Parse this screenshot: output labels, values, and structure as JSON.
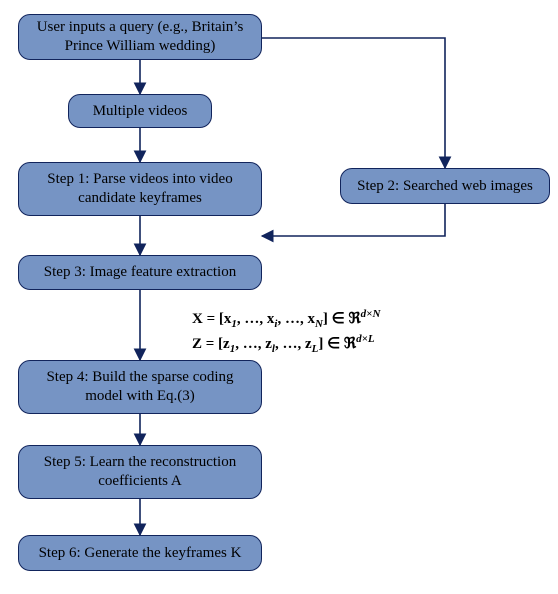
{
  "nodes": {
    "n_input": {
      "label": "User inputs a query (e.g., Britain’s Prince William wedding)"
    },
    "n_videos": {
      "label": "Multiple videos"
    },
    "n_step1": {
      "label": "Step 1: Parse videos into video candidate keyframes"
    },
    "n_step2": {
      "label": "Step 2: Searched web images"
    },
    "n_step3": {
      "label": "Step 3: Image feature extraction"
    },
    "n_step4": {
      "label": "Step 4: Build the sparse coding model with Eq.(3)"
    },
    "n_step5": {
      "label": "Step 5:  Learn the reconstruction coefficients A"
    },
    "n_step6": {
      "label": "Step 6: Generate the keyframes K"
    }
  },
  "equations": {
    "line1_prefix": "X = [x",
    "line1_sub1": "1",
    "line1_mid1": ", …, x",
    "line1_subi": "i",
    "line1_mid2": ", …, x",
    "line1_subN": "N",
    "line1_suffix": "] ∈ ℜ",
    "line1_exp": "d×N",
    "line2_prefix": "Z = [z",
    "line2_sub1": "1",
    "line2_mid1": ", …, z",
    "line2_subl": "l",
    "line2_mid2": ", …, z",
    "line2_subL": "L",
    "line2_suffix": "] ∈ ℜ",
    "line2_exp": "d×L"
  },
  "chart_data": {
    "type": "diagram",
    "nodes": [
      {
        "id": "n_input",
        "label": "User inputs a query (e.g., Britain’s Prince William wedding)"
      },
      {
        "id": "n_videos",
        "label": "Multiple videos"
      },
      {
        "id": "n_step1",
        "label": "Step 1: Parse videos into video candidate keyframes"
      },
      {
        "id": "n_step2",
        "label": "Step 2: Searched web images"
      },
      {
        "id": "n_step3",
        "label": "Step 3: Image feature extraction"
      },
      {
        "id": "n_step4",
        "label": "Step 4: Build the sparse coding model with Eq.(3)"
      },
      {
        "id": "n_step5",
        "label": "Step 5:  Learn the reconstruction coefficients A"
      },
      {
        "id": "n_step6",
        "label": "Step 6: Generate the keyframes K"
      }
    ],
    "edges": [
      {
        "from": "n_input",
        "to": "n_videos"
      },
      {
        "from": "n_videos",
        "to": "n_step1"
      },
      {
        "from": "n_step1",
        "to": "n_step3"
      },
      {
        "from": "n_input",
        "to": "n_step2"
      },
      {
        "from": "n_step2",
        "to": "n_step3"
      },
      {
        "from": "n_step3",
        "to": "n_step4",
        "annotation": "X = [x_1, …, x_i, …, x_N] ∈ ℜ^{d×N}; Z = [z_1, …, z_l, …, z_L] ∈ ℜ^{d×L}"
      },
      {
        "from": "n_step4",
        "to": "n_step5"
      },
      {
        "from": "n_step5",
        "to": "n_step6"
      }
    ],
    "colors": {
      "node_fill": "#7694c4",
      "node_stroke": "#11245c",
      "edge": "#11245c"
    }
  }
}
